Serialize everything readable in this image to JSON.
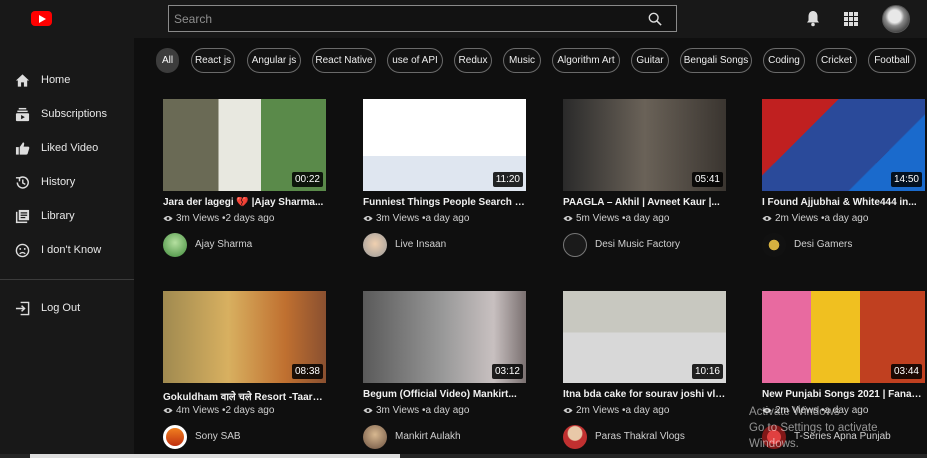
{
  "header": {
    "search_placeholder": "Search",
    "logo_icon": "youtube-logo-icon",
    "icons": [
      "search-icon",
      "bell-icon",
      "apps-grid-icon",
      "avatar"
    ]
  },
  "sidebar": {
    "items": [
      {
        "label": "Home",
        "icon": "home-icon"
      },
      {
        "label": "Subscriptions",
        "icon": "subscriptions-icon"
      },
      {
        "label": "Liked Video",
        "icon": "thumbs-up-icon"
      },
      {
        "label": "History",
        "icon": "history-icon"
      },
      {
        "label": "Library",
        "icon": "library-icon"
      },
      {
        "label": "I don't Know",
        "icon": "sad-face-icon"
      }
    ],
    "logout": {
      "label": "Log Out",
      "icon": "logout-icon"
    }
  },
  "chips": [
    "All",
    "React js",
    "Angular js",
    "React Native",
    "use of API",
    "Redux",
    "Music",
    "Algorithm Art",
    "Guitar",
    "Bengali Songs",
    "Coding",
    "Cricket",
    "Football"
  ],
  "videos": [
    {
      "title": "Jara der lagegi 💔 |Ajay Sharma...",
      "views": "3m Views",
      "age": "2 days ago",
      "duration": "00:22",
      "channel": "Ajay Sharma",
      "thumb_color": "#5a7a3a",
      "avatar_color": "#5aa35a"
    },
    {
      "title": "Funniest Things People Search on...",
      "views": "3m Views",
      "age": "a day ago",
      "duration": "11:20",
      "channel": "Live Insaan",
      "thumb_color": "#ffffff",
      "avatar_color": "#e0e0e0"
    },
    {
      "title": "PAAGLA – Akhil | Avneet Kaur |...",
      "views": "5m Views",
      "age": "a day ago",
      "duration": "05:41",
      "channel": "Desi Music Factory",
      "thumb_color": "#3a3a3a",
      "avatar_color": "#222222"
    },
    {
      "title": "I Found Ajjubhai & White444 in...",
      "views": "2m Views",
      "age": "a day ago",
      "duration": "14:50",
      "channel": "Desi Gamers",
      "thumb_color": "#1a3a7a",
      "avatar_color": "#111111"
    },
    {
      "title": "Gokuldham वाले चले Resort -Taarak...",
      "views": "4m Views",
      "age": "2 days ago",
      "duration": "08:38",
      "channel": "Sony SAB",
      "thumb_color": "#c8a040",
      "avatar_color": "#f08020"
    },
    {
      "title": "Begum (Official Video) Mankirt...",
      "views": "3m Views",
      "age": "a day ago",
      "duration": "03:12",
      "channel": "Mankirt Aulakh",
      "thumb_color": "#7a7a7a",
      "avatar_color": "#c0a080"
    },
    {
      "title": "Itna bda cake for sourav joshi vlog...",
      "views": "2m Views",
      "age": "a day ago",
      "duration": "10:16",
      "channel": "Paras Thakral Vlogs",
      "thumb_color": "#b0b0b0",
      "avatar_color": "#d04040"
    },
    {
      "title": "New Punjabi Songs 2021 | Fanaa :...",
      "views": "2m Views",
      "age": "a day ago",
      "duration": "03:44",
      "channel": "T-Series Apna Punjab",
      "thumb_color": "#f0c020",
      "avatar_color": "#c02020"
    }
  ],
  "watermark": {
    "line1": "Activate Windows",
    "line2": "Go to Settings to activate Windows."
  }
}
